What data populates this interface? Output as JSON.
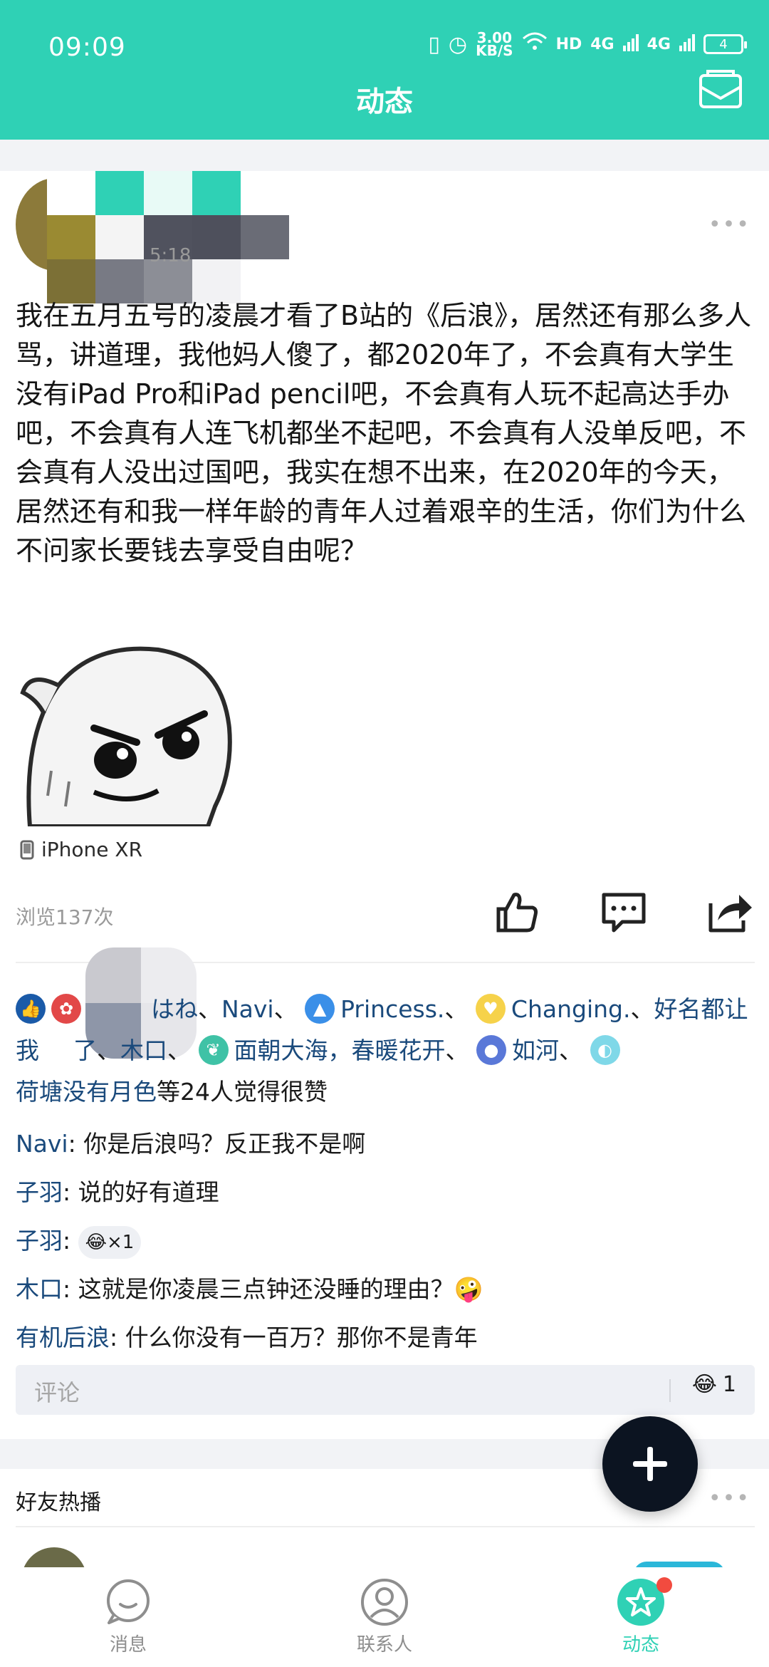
{
  "status_bar": {
    "time": "09:09",
    "speed_value": "3.00",
    "speed_unit": "KB/S",
    "hd_label": "HD",
    "net1": "4G",
    "net2": "4G",
    "battery": "4"
  },
  "header": {
    "title": "动态",
    "mail_icon": "mail-icon"
  },
  "post": {
    "time_partial": "5:18",
    "text": "我在五月五号的凌晨才看了B站的《后浪》，居然还有那么多人骂，讲道理，我他妈人傻了，都2020年了，不会真有大学生没有iPad Pro和iPad pencil吧，不会真有人玩不起高达手办吧，不会真有人连飞机都坐不起吧，不会真有人没单反吧，不会真有人没出过国吧，我实在想不出来，在2020年的今天，居然还有和我一样年龄的青年人过着艰辛的生活，你们为什么不问家长要钱去享受自由呢？",
    "device": "iPhone XR",
    "views": "浏览137次"
  },
  "likes": {
    "name1_partial": "はね",
    "name2": "Navi",
    "name3": "Princess.",
    "name4": "Changing.",
    "name5_partial_a": "好",
    "name5_partial_b": "名都让我",
    "name5_partial_c": "了",
    "name6": "木口",
    "name7": "面朝大海，春暖花开",
    "name8": "如河",
    "name9": "荷塘没有月色",
    "summary": "等24人觉得很赞",
    "sep": "、"
  },
  "comments": [
    {
      "author": "Navi",
      "text": "你是后浪吗？反正我不是啊"
    },
    {
      "author": "子羽",
      "text": "说的好有道理"
    },
    {
      "author": "子羽",
      "text": "",
      "reaction": "×1"
    },
    {
      "author": "木口",
      "text": "这就是你凌晨三点钟还没睡的理由？"
    },
    {
      "author": "有机后浪",
      "text": "什么你没有一百万？那你不是青年"
    }
  ],
  "comment_input": {
    "placeholder": "评论",
    "emoji_count": "1"
  },
  "friends_feed": {
    "title": "好友热播"
  },
  "bottom_nav": [
    {
      "label": "消息",
      "icon": "chat-bubble-icon"
    },
    {
      "label": "联系人",
      "icon": "contact-person-icon"
    },
    {
      "label": "动态",
      "icon": "star-feed-icon"
    }
  ],
  "colors": {
    "accent": "#2fd1b5",
    "link": "#1a4a7c",
    "fab": "#0c1421",
    "badge": "#f24b3f"
  }
}
